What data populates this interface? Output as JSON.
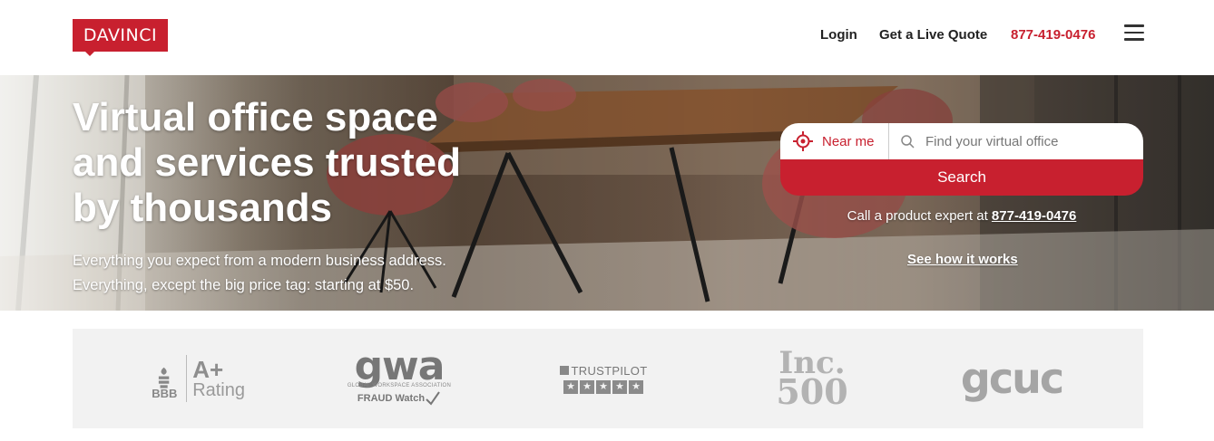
{
  "header": {
    "logo_text": "DAVINCI",
    "nav": {
      "login": "Login",
      "quote": "Get a Live Quote",
      "phone": "877-419-0476"
    }
  },
  "hero": {
    "title": "Virtual office space and services trusted by thousands",
    "subtitle_line1": "Everything you expect from a modern business address.",
    "subtitle_line2": "Everything, except the big price tag: starting at $50.",
    "search": {
      "near_me": "Near me",
      "placeholder": "Find your virtual office",
      "button": "Search"
    },
    "call_text": "Call a product expert at",
    "call_phone": "877-419-0476",
    "see_how": "See how it works"
  },
  "trust": {
    "bbb": {
      "letters": "BBB",
      "grade": "A+",
      "rating": "Rating"
    },
    "gwa": {
      "name": "gwa",
      "tagline": "GLOBAL WORKSPACE ASSOCIATION",
      "fraud": "FRAUD Watch"
    },
    "trustpilot": {
      "name": "TRUSTPILOT"
    },
    "inc": {
      "top": "Inc.",
      "bottom": "500"
    },
    "gcuc": {
      "name": "gcuc"
    }
  },
  "colors": {
    "brand_red": "#c8202f",
    "trust_bg": "#f2f2f2"
  }
}
